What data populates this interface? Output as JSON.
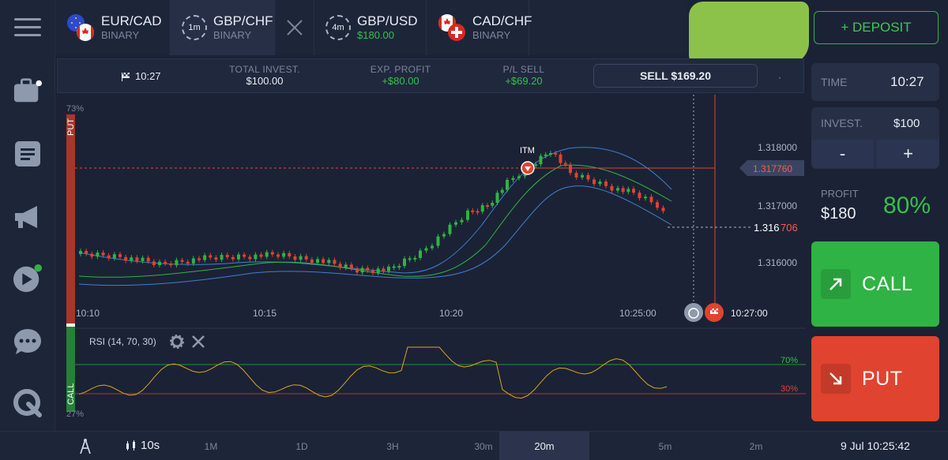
{
  "tabs": [
    {
      "name": "EUR/CAD",
      "sub": "BINARY",
      "badge": ""
    },
    {
      "name": "GBP/CHF",
      "sub": "BINARY",
      "badge": "1m"
    },
    {
      "name": "GBP/USD",
      "sub": "$180.00",
      "badge": "4m"
    },
    {
      "name": "CAD/CHF",
      "sub": "BINARY",
      "badge": ""
    }
  ],
  "deposit_label": "+ DEPOSIT",
  "infobar": {
    "time": "10:27",
    "total_invest_label": "TOTAL INVEST.",
    "total_invest_value": "$100.00",
    "exp_profit_label": "EXP. PROFIT",
    "exp_profit_value": "+$80.00",
    "pl_sell_label": "P/L SELL",
    "pl_sell_value": "+$69.20",
    "sell_button": "SELL $169.20",
    "dot": "·"
  },
  "chart": {
    "put_label": "PUT",
    "call_label": "CALL",
    "put_pct": "73%",
    "call_pct": "27%",
    "itm_label": "ITM",
    "price_ticks": [
      "1.318000",
      "1.317000",
      "1.316000"
    ],
    "entry_price": "1.317760",
    "current_price_main": "1.316",
    "current_price_tail": "706",
    "time_ticks": [
      "10:10",
      "10:15",
      "10:20",
      "10:25:00"
    ],
    "expiry_time": "10:27:00",
    "rsi_label": "RSI  (14,  70,  30)",
    "rsi_upper": "70%",
    "rsi_lower": "30%"
  },
  "chart_data": {
    "type": "candlestick",
    "y_axis_ticks": [
      1.316,
      1.317,
      1.318
    ],
    "entry_price": 1.31776,
    "current_price": 1.316706,
    "x_ticks": [
      "10:10",
      "10:15",
      "10:20",
      "10:25:00"
    ],
    "expiry": "10:27:00",
    "rsi": {
      "period": 14,
      "upper": 70,
      "lower": 30
    }
  },
  "panel": {
    "time_label": "TIME",
    "time_value": "10:27",
    "invest_label": "INVEST.",
    "invest_value": "$100",
    "minus": "-",
    "plus": "+",
    "profit_label": "PROFIT",
    "profit_value": "$180",
    "profit_pct": "80%",
    "call_label": "CALL",
    "put_label": "PUT"
  },
  "bottombar": {
    "timeframe": "10s",
    "periods": [
      "1M",
      "1D",
      "3H",
      "30m",
      "20m",
      "5m",
      "2m"
    ],
    "active_period": "20m",
    "datetime": "9 Jul 10:25:42"
  },
  "colors": {
    "bg": "#1b2235",
    "green": "#2fb344",
    "red": "#e0432f",
    "redact": "#8cc24a"
  }
}
